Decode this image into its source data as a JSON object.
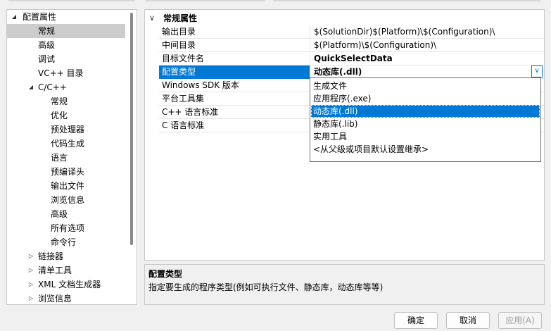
{
  "tree": {
    "items": [
      {
        "label": "配置属性",
        "expanded": true,
        "arrow": "◢"
      },
      {
        "label": "常规"
      },
      {
        "label": "高级"
      },
      {
        "label": "调试"
      },
      {
        "label": "VC++ 目录"
      },
      {
        "label": "C/C++",
        "expanded": true,
        "arrow": "◢"
      },
      {
        "label": "常规"
      },
      {
        "label": "优化"
      },
      {
        "label": "预处理器"
      },
      {
        "label": "代码生成"
      },
      {
        "label": "语言"
      },
      {
        "label": "预编译头"
      },
      {
        "label": "输出文件"
      },
      {
        "label": "浏览信息"
      },
      {
        "label": "高级"
      },
      {
        "label": "所有选项"
      },
      {
        "label": "命令行"
      },
      {
        "label": "链接器",
        "arrow": "▷"
      },
      {
        "label": "清单工具",
        "arrow": "▷"
      },
      {
        "label": "XML 文档生成器",
        "arrow": "▷"
      },
      {
        "label": "浏览信息",
        "arrow": "▷"
      }
    ],
    "selected_index": 1
  },
  "grid": {
    "category": "常规属性",
    "category_chevron": "∨",
    "rows": [
      {
        "name": "输出目录",
        "value": "$(SolutionDir)$(Platform)\\$(Configuration)\\"
      },
      {
        "name": "中间目录",
        "value": "$(Platform)\\$(Configuration)\\"
      },
      {
        "name": "目标文件名",
        "value": "QuickSelectData"
      },
      {
        "name": "配置类型",
        "value": "动态库(.dll)"
      },
      {
        "name": "Windows SDK 版本",
        "value": ""
      },
      {
        "name": "平台工具集",
        "value": ""
      },
      {
        "name": "C++ 语言标准",
        "value": ""
      },
      {
        "name": "C 语言标准",
        "value": ""
      }
    ],
    "combo_chevron": "∨"
  },
  "dropdown": {
    "options": [
      "生成文件",
      "应用程序(.exe)",
      "动态库(.dll)",
      "静态库(.lib)",
      "实用工具",
      "<从父级或项目默认设置继承>"
    ],
    "selected_index": 2
  },
  "description": {
    "title": "配置类型",
    "text": "指定要生成的程序类型(例如可执行文件、静态库，动态库等等)"
  },
  "buttons": {
    "ok": "确定",
    "cancel": "取消",
    "apply": "应用(A)"
  },
  "colors": {
    "selection": "#0078d4",
    "tree_selected": "#cccccc"
  }
}
